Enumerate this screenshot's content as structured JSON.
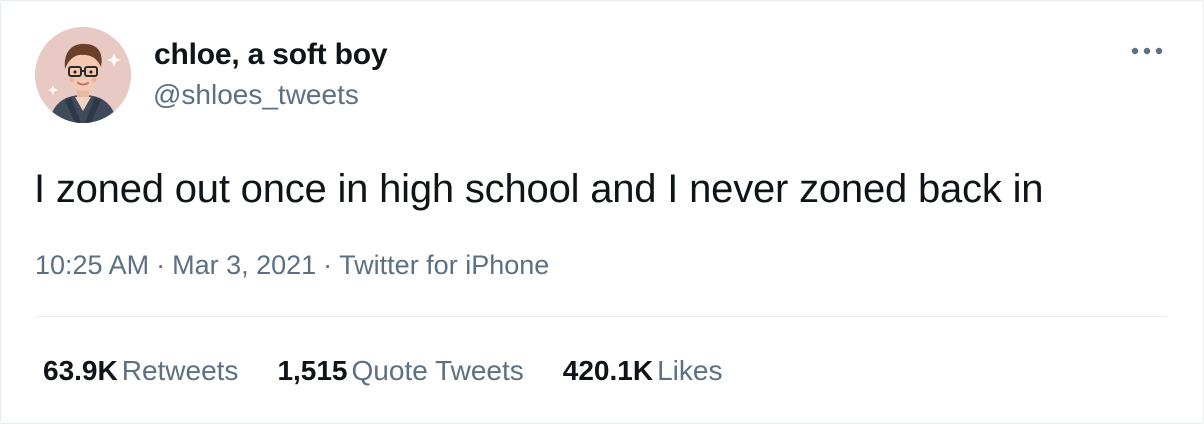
{
  "author": {
    "display_name": "chloe, a soft boy",
    "handle": "@shloes_tweets",
    "avatar_icon": "illustrated-avatar"
  },
  "menu_icon": "more-options-icon",
  "tweet": {
    "text": "I zoned out once in high school and I never zoned back in"
  },
  "meta": {
    "time": "10:25 AM",
    "date": "Mar 3, 2021",
    "source": "Twitter for iPhone",
    "separator": "·"
  },
  "stats": [
    {
      "count": "63.9K",
      "label": "Retweets"
    },
    {
      "count": "1,515",
      "label": "Quote Tweets"
    },
    {
      "count": "420.1K",
      "label": "Likes"
    }
  ],
  "colors": {
    "text": "#0f1419",
    "secondary": "#5b7083",
    "border": "#e6ecf0",
    "avatar_bg": "#e9c9c4"
  }
}
